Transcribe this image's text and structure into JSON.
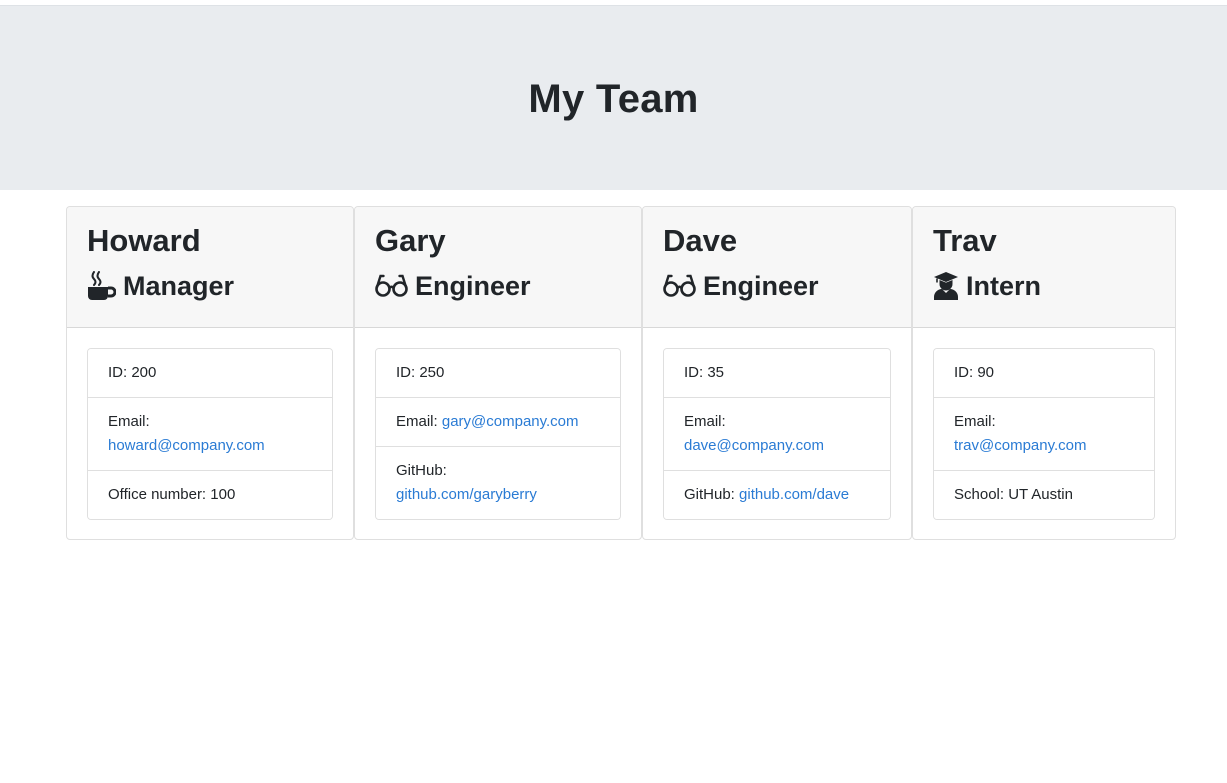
{
  "header": {
    "title": "My Team"
  },
  "team": {
    "howard": {
      "name": "Howard",
      "role": "Manager",
      "icon": "mug-hot-icon",
      "id": "ID: 200",
      "email_label": "Email:",
      "email": "howard@company.com",
      "office": "Office number: 100"
    },
    "gary": {
      "name": "Gary",
      "role": "Engineer",
      "icon": "glasses-icon",
      "id": "ID: 250",
      "email_label": "Email:",
      "email": "gary@company.com",
      "github_label": "GitHub:",
      "github": "github.com/garyberry"
    },
    "dave": {
      "name": "Dave",
      "role": "Engineer",
      "icon": "glasses-icon",
      "id": "ID: 35",
      "email_label": "Email:",
      "email": "dave@company.com",
      "github_label": "GitHub:",
      "github": "github.com/dave"
    },
    "trav": {
      "name": "Trav",
      "role": "Intern",
      "icon": "user-graduate-icon",
      "id": "ID: 90",
      "email_label": "Email:",
      "email": "trav@company.com",
      "school": "School: UT Austin"
    }
  },
  "colors": {
    "link": "#2a7bd4",
    "header_bg": "#e9ecef",
    "card_header_bg": "#f7f7f7"
  }
}
